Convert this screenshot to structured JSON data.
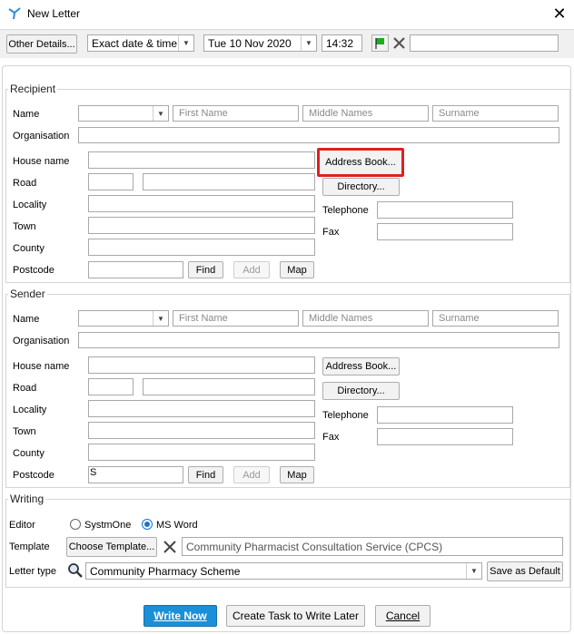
{
  "window": {
    "title": "New Letter"
  },
  "toolbar": {
    "other_details": "Other Details...",
    "date_mode": "Exact date & time",
    "date": "Tue 10 Nov 2020",
    "time": "14:32",
    "flag_color": "#22a822",
    "extra_field": ""
  },
  "recipient": {
    "legend": "Recipient",
    "name_label": "Name",
    "title_value": "",
    "first_name_ph": "First Name",
    "middle_names_ph": "Middle Names",
    "surname_ph": "Surname",
    "organisation_label": "Organisation",
    "house_name_label": "House name",
    "road_label": "Road",
    "locality_label": "Locality",
    "town_label": "Town",
    "county_label": "County",
    "postcode_label": "Postcode",
    "postcode_value": "",
    "telephone_label": "Telephone",
    "fax_label": "Fax",
    "address_book": "Address Book...",
    "directory": "Directory...",
    "find": "Find",
    "add": "Add",
    "map": "Map"
  },
  "sender": {
    "legend": "Sender",
    "name_label": "Name",
    "title_value": "",
    "first_name_ph": "First Name",
    "middle_names_ph": "Middle Names",
    "surname_ph": "Surname",
    "organisation_label": "Organisation",
    "house_name_label": "House name",
    "road_label": "Road",
    "locality_label": "Locality",
    "town_label": "Town",
    "county_label": "County",
    "postcode_label": "Postcode",
    "postcode_value": "S",
    "telephone_label": "Telephone",
    "fax_label": "Fax",
    "address_book": "Address Book...",
    "directory": "Directory...",
    "find": "Find",
    "add": "Add",
    "map": "Map"
  },
  "writing": {
    "legend": "Writing",
    "editor_label": "Editor",
    "editor_options": [
      "SystmOne",
      "MS Word"
    ],
    "editor_selected": "MS Word",
    "template_label": "Template",
    "choose_template": "Choose Template...",
    "template_value": "Community Pharmacist Consultation Service (CPCS)",
    "letter_type_label": "Letter type",
    "letter_type_value": "Community Pharmacy Scheme",
    "save_default": "Save as Default"
  },
  "footer": {
    "write_now": "Write Now",
    "create_task": "Create Task to Write Later",
    "cancel": "Cancel"
  },
  "colors": {
    "accent": "#1b8fd8",
    "highlight": "#e0201f"
  }
}
